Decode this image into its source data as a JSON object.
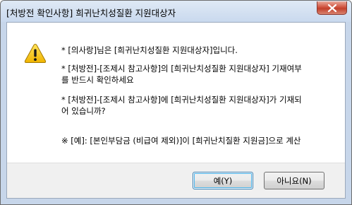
{
  "window": {
    "title": "[처방전 확인사항] 희귀난치성질환 지원대상자"
  },
  "dialog": {
    "icon": "warning-icon",
    "messages": [
      "* [의사랑]님은 [희귀난치성질환 지원대상자]입니다.",
      "* [처방전]-[조제시 참고사항]의 [희귀난치성질환 지원대상자] 기재여부",
      "를 반드시 확인하세요",
      "* [처방전]-[조제시 참고사항]에 [희귀난치성질환 지원대상자]가 기재되",
      "어 있습니까?",
      "※ [예]: [본인부담금 (비급여 제외)]이 [희귀난치질환 지원금]으로 계산"
    ]
  },
  "buttons": {
    "yes_label": "예(Y)",
    "no_label": "아니요(N)"
  },
  "colors": {
    "titlebar": "#c9d9ee",
    "close_button": "#c2402b",
    "warning_fill": "#f5c400",
    "default_button_focus": "#48b1e8"
  }
}
